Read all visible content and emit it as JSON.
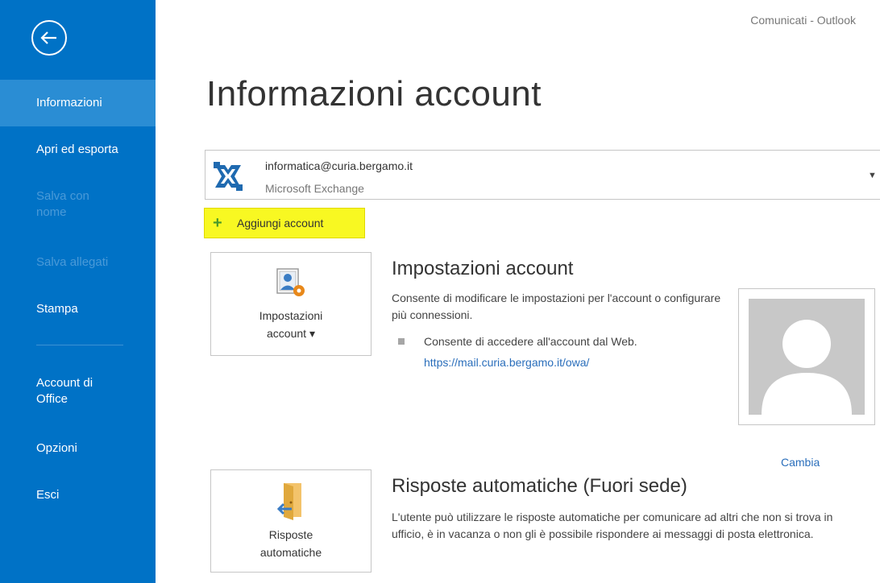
{
  "window": {
    "title": "Comunicati - Outlook"
  },
  "sidebar": {
    "back_icon": "back-arrow-icon",
    "items": [
      {
        "label": "Informazioni"
      },
      {
        "label": "Apri ed esporta"
      },
      {
        "label": "Salva con nome"
      },
      {
        "label": "Salva allegati"
      },
      {
        "label": "Stampa"
      },
      {
        "label": "Account di Office"
      },
      {
        "label": "Opzioni"
      },
      {
        "label": "Esci"
      }
    ]
  },
  "main": {
    "title": "Informazioni account",
    "account": {
      "email": "informatica@curia.bergamo.it",
      "type": "Microsoft Exchange",
      "icon": "exchange-icon",
      "caret": "▼"
    },
    "add_account_label": "Aggiungi account",
    "account_settings": {
      "button_line1": "Impostazioni",
      "button_line2": "account ▾",
      "title": "Impostazioni account",
      "description": "Consente di modificare le impostazioni per l'account o configurare più connessioni.",
      "bullet": "Consente di accedere all'account dal Web.",
      "link": "https://mail.curia.bergamo.it/owa/"
    },
    "profile_photo": {
      "change_label": "Cambia"
    },
    "auto_replies": {
      "button_line1": "Risposte",
      "button_line2": "automatiche",
      "title": "Risposte automatiche (Fuori sede)",
      "description": "L'utente può utilizzare le risposte automatiche per comunicare ad altri che non si trova in ufficio, è in vacanza o non gli è possibile rispondere ai messaggi di posta elettronica."
    }
  },
  "colors": {
    "sidebar": "#0072c6",
    "sidebar_selected": "#2a8dd4",
    "highlight": "#f8f822",
    "link": "#2a6ebb"
  }
}
